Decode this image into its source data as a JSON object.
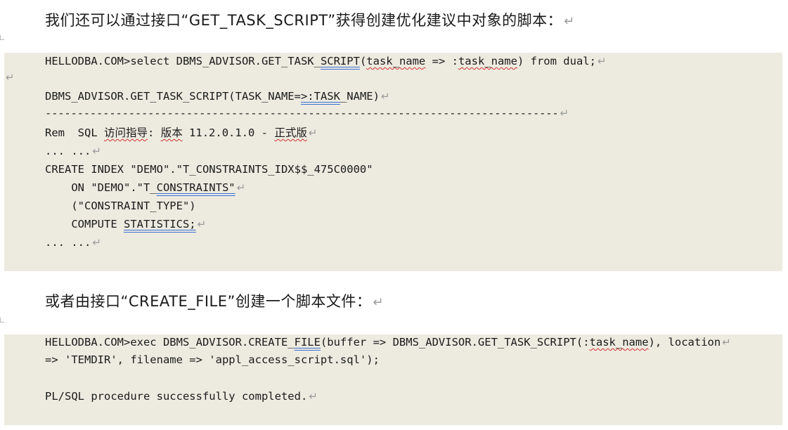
{
  "paragraph1": "我们还可以通过接口“GET_TASK_SCRIPT”获得创建优化建议中对象的脚本：",
  "code_block1": {
    "line1_a": "HELLODBA.COM>select DBMS_ADVISOR.GET_TASK_",
    "line1_b": "SCRIPT",
    "line1_c": "(",
    "line1_d": "task_name",
    "line1_e": " => :",
    "line1_f": "task_name",
    "line1_g": ") from dual;",
    "line2_a": "DBMS_ADVISOR.GET_TASK_SCRIPT(TASK_NAME=",
    "line2_b": ">:TASK",
    "line2_c": "_NAME)",
    "line3": "--------------------------------------------------------------------------------",
    "line4_a": "Rem  SQL ",
    "line4_b": "访问指导",
    "line4_c": ": ",
    "line4_d": "版本",
    "line4_e": " 11.2.0.1.0 - ",
    "line4_f": "正式版",
    "line5": "... ...",
    "line6": "CREATE INDEX \"DEMO\".\"T_CONSTRAINTS_IDX$$_475C0000\"",
    "line7_a": "    ON \"DEMO\".\"T_",
    "line7_b": "CONSTRAINTS\"",
    "line8": "    (\"CONSTRAINT_TYPE\")",
    "line9_a": "    COMPUTE ",
    "line9_b": "STATISTICS;",
    "line10": "... ..."
  },
  "paragraph2": "或者由接口“CREATE_FILE”创建一个脚本文件：",
  "code_block2": {
    "line1_a": "HELLODBA.COM>exec DBMS_ADVISOR.CREATE_",
    "line1_b": "FILE",
    "line1_c": "(buffer => DBMS_ADVISOR.GET_TASK_SCRIPT(:",
    "line1_d": "task_name",
    "line1_e": "), location",
    "line2": "=> 'TEMDIR', filename => 'appl_access_script.sql');",
    "line3": "PL/SQL procedure successfully completed."
  },
  "paragraph_mark": "↵"
}
